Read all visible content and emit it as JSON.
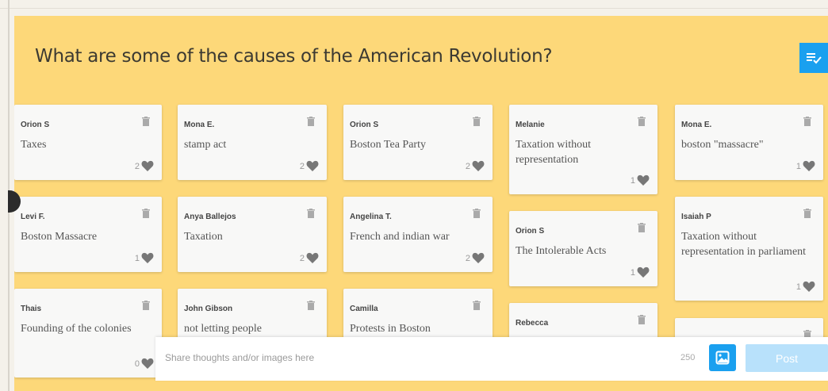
{
  "question": "What are some of the causes of the American Revolution?",
  "cards": [
    {
      "author": "Orion S",
      "text": "Taxes",
      "likes": "2"
    },
    {
      "author": "Mona E.",
      "text": "stamp act",
      "likes": "2"
    },
    {
      "author": "Orion S",
      "text": "Boston Tea Party",
      "likes": "2"
    },
    {
      "author": "Melanie",
      "text": "Taxation without representation",
      "likes": "1"
    },
    {
      "author": "Mona E.",
      "text": "boston \"massacre\"",
      "likes": "1"
    },
    {
      "author": "Levi F.",
      "text": "Boston Massacre",
      "likes": "1"
    },
    {
      "author": "Anya Ballejos",
      "text": "Taxation",
      "likes": "2"
    },
    {
      "author": "Angelina T.",
      "text": "French and indian war",
      "likes": "2"
    },
    {
      "author": "Orion S",
      "text": "The Intolerable Acts",
      "likes": "1"
    },
    {
      "author": "Isaiah P",
      "text": "Taxation without representation in parliament",
      "likes": "1"
    },
    {
      "author": "Thais",
      "text": "Founding of the colonies",
      "likes": "0"
    },
    {
      "author": "John Gibson",
      "text": "not letting people",
      "likes": ""
    },
    {
      "author": "Camilla",
      "text": "Protests in Boston",
      "likes": ""
    },
    {
      "author": "Rebecca",
      "text": "",
      "likes": ""
    },
    {
      "author": "",
      "text": "",
      "likes": ""
    }
  ],
  "composer": {
    "placeholder": "Share thoughts and/or images here",
    "char_count": "250",
    "post_label": "Post"
  },
  "colors": {
    "background": "#fdd879",
    "accent": "#1aa0ef",
    "post_disabled": "#b8e1fb"
  },
  "icons": {
    "sort": "sort-check-icon",
    "trash": "trash-icon",
    "heart": "heart-icon",
    "image": "image-icon"
  }
}
